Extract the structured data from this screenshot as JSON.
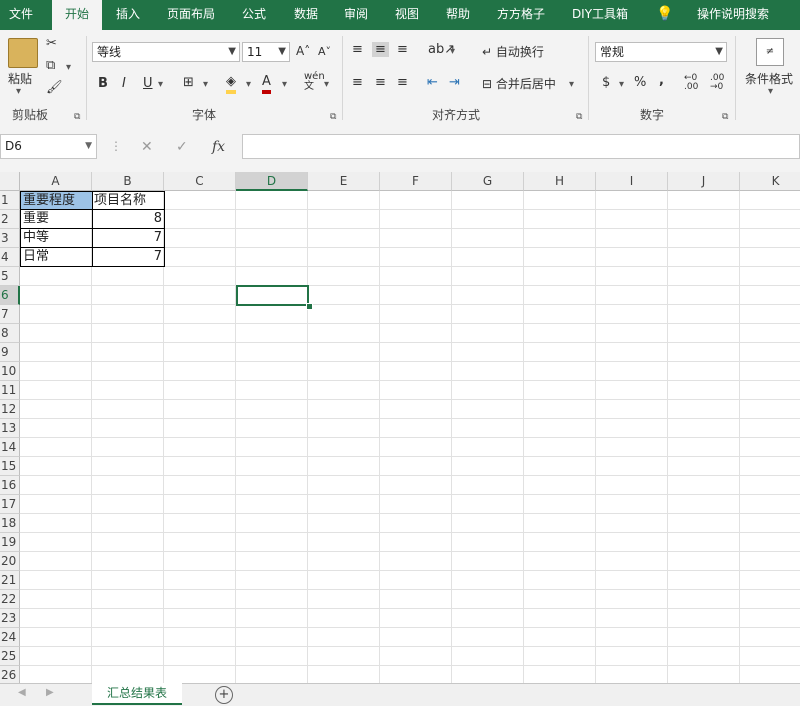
{
  "ribbon_tabs": [
    "文件",
    "开始",
    "插入",
    "页面布局",
    "公式",
    "数据",
    "审阅",
    "视图",
    "帮助",
    "方方格子",
    "DIY工具箱",
    "操作说明搜索"
  ],
  "clipboard": {
    "paste_label": "粘贴",
    "group_label": "剪贴板"
  },
  "font": {
    "family": "等线",
    "size": "11",
    "group_label": "字体",
    "bold": "B",
    "italic": "I",
    "underline": "U",
    "font_color_letter": "A",
    "phonetic": "wén"
  },
  "alignment": {
    "wrap_label": "自动换行",
    "merge_label": "合并后居中",
    "group_label": "对齐方式"
  },
  "number": {
    "format": "常规",
    "currency": "$",
    "percent": "%",
    "comma": ",",
    "group_label": "数字"
  },
  "styles": {
    "conditional_label": "条件格式"
  },
  "formula_bar": {
    "name_box": "D6",
    "fx": "fx",
    "cancel": "✕",
    "enter": "✓"
  },
  "columns": [
    "A",
    "B",
    "C",
    "D",
    "E",
    "F",
    "G",
    "H",
    "I",
    "J",
    "K"
  ],
  "rows": [
    "1",
    "2",
    "3",
    "4",
    "5",
    "6",
    "7",
    "8",
    "9",
    "10",
    "11",
    "12",
    "13",
    "14",
    "15",
    "16",
    "17",
    "18",
    "19",
    "20",
    "21",
    "22",
    "23",
    "24",
    "25",
    "26"
  ],
  "selected": {
    "col": "D",
    "row": "6"
  },
  "table": {
    "header": [
      "重要程度",
      "项目名称"
    ],
    "rows": [
      [
        "重要",
        "8"
      ],
      [
        "中等",
        "7"
      ],
      [
        "日常",
        "7"
      ]
    ]
  },
  "sheet": {
    "name": "汇总结果表",
    "add": "⊕"
  },
  "colors": {
    "accent": "#217346",
    "header_fill": "#9dc3e6"
  }
}
